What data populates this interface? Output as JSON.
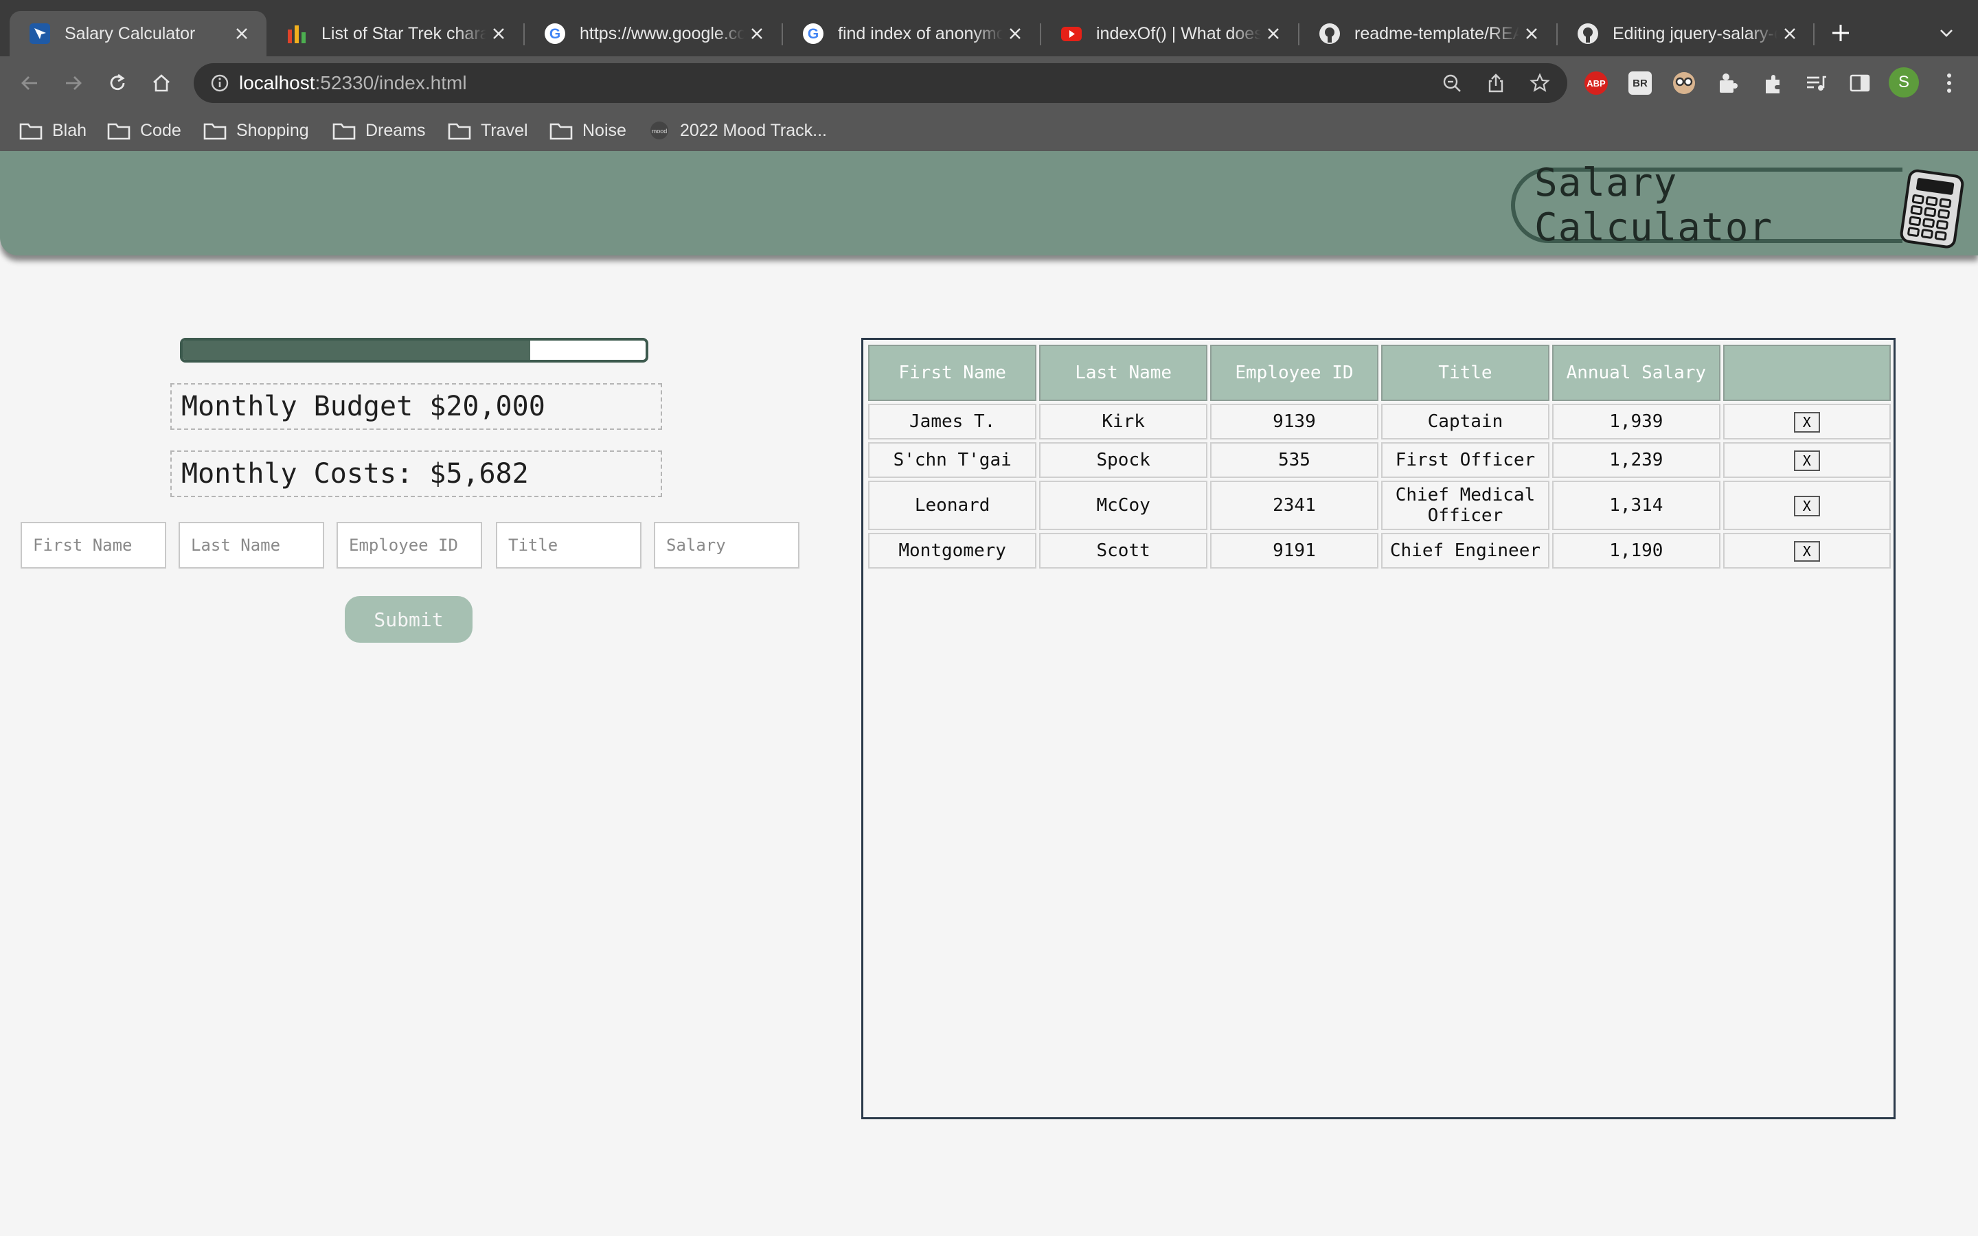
{
  "browser": {
    "tabs": [
      {
        "title": "Salary Calculator",
        "icon": "app-favicon",
        "active": true
      },
      {
        "title": "List of Star Trek characters",
        "icon": "bar-chart-favicon",
        "active": false
      },
      {
        "title": "https://www.google.com",
        "icon": "google-favicon",
        "active": false
      },
      {
        "title": "find index of anonymous",
        "icon": "google-favicon",
        "active": false
      },
      {
        "title": "indexOf() | What does",
        "icon": "youtube-favicon",
        "active": false
      },
      {
        "title": "readme-template/README",
        "icon": "github-favicon",
        "active": false
      },
      {
        "title": "Editing jquery-salary-calculator",
        "icon": "github-favicon",
        "active": false
      }
    ],
    "url_host": "localhost",
    "url_rest": ":52330/index.html",
    "bookmarks": [
      "Blah",
      "Code",
      "Shopping",
      "Dreams",
      "Travel",
      "Noise",
      "2022 Mood Track..."
    ],
    "extensions": {
      "abp": "ABP",
      "br": "BR"
    },
    "profile_initial": "S"
  },
  "header": {
    "title": "Salary Calculator"
  },
  "budget": {
    "monthly_budget_text": "Monthly Budget $20,000",
    "monthly_costs_text": "Monthly Costs: $5,682",
    "progress_fraction": 0.75
  },
  "form": {
    "first_name_placeholder": "First Name",
    "last_name_placeholder": "Last Name",
    "employee_id_placeholder": "Employee ID",
    "title_placeholder": "Title",
    "salary_placeholder": "Salary",
    "submit_label": "Submit"
  },
  "table": {
    "headers": [
      "First Name",
      "Last Name",
      "Employee ID",
      "Title",
      "Annual Salary",
      ""
    ],
    "delete_label": "X",
    "rows": [
      {
        "first": "James T.",
        "last": "Kirk",
        "id": "9139",
        "title": "Captain",
        "salary": "1,939"
      },
      {
        "first": "S'chn T'gai",
        "last": "Spock",
        "id": "535",
        "title": "First Officer",
        "salary": "1,239"
      },
      {
        "first": "Leonard",
        "last": "McCoy",
        "id": "2341",
        "title": "Chief Medical Officer",
        "salary": "1,314"
      },
      {
        "first": "Montgomery",
        "last": "Scott",
        "id": "9191",
        "title": "Chief Engineer",
        "salary": "1,190"
      }
    ]
  },
  "colors": {
    "header_bg": "#769385",
    "accent_dark": "#3d5a4e",
    "table_header_bg": "#a6c0b2",
    "progress_fill": "#4f6a5d",
    "page_bg": "#f5f5f5"
  }
}
